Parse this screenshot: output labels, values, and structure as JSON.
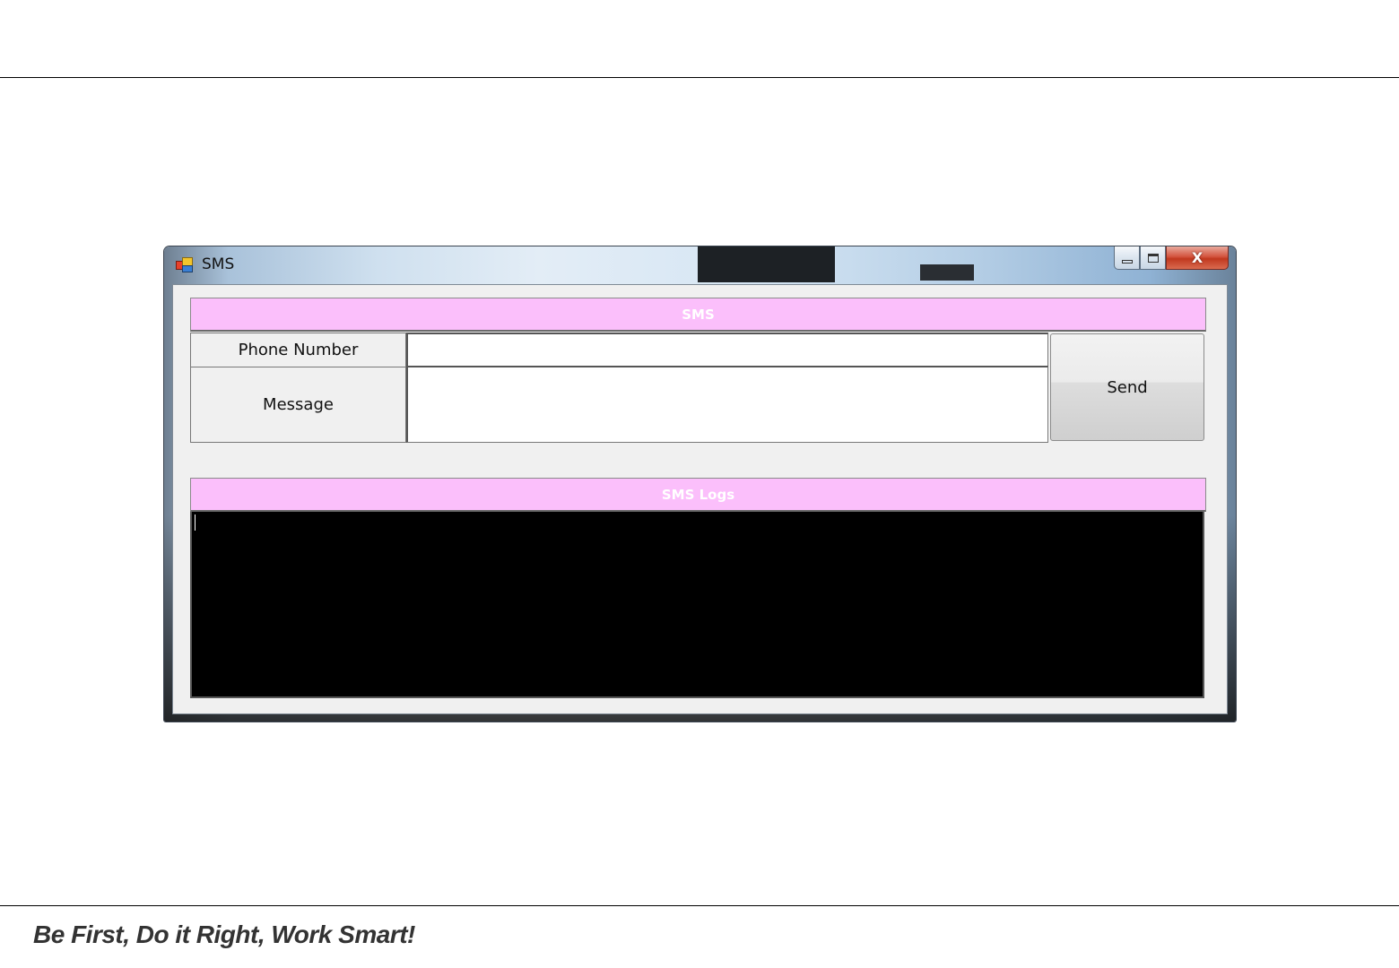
{
  "window": {
    "title": "SMS",
    "app_icon": "windows-form-icon",
    "controls": {
      "minimize_icon": "minimize-icon",
      "maximize_icon": "maximize-icon",
      "close_label": "X"
    }
  },
  "sms_section": {
    "header": "SMS",
    "phone_label": "Phone Number",
    "phone_value": "",
    "message_label": "Message",
    "message_value": "",
    "send_label": "Send"
  },
  "logs_section": {
    "header": "SMS Logs",
    "log_text": ""
  },
  "footer": {
    "slogan": "Be First, Do it Right, Work Smart!"
  },
  "colors": {
    "band_bg": "#fbbffb",
    "band_text": "#ffffff",
    "log_bg": "#000000",
    "client_bg": "#f0f0f0"
  }
}
